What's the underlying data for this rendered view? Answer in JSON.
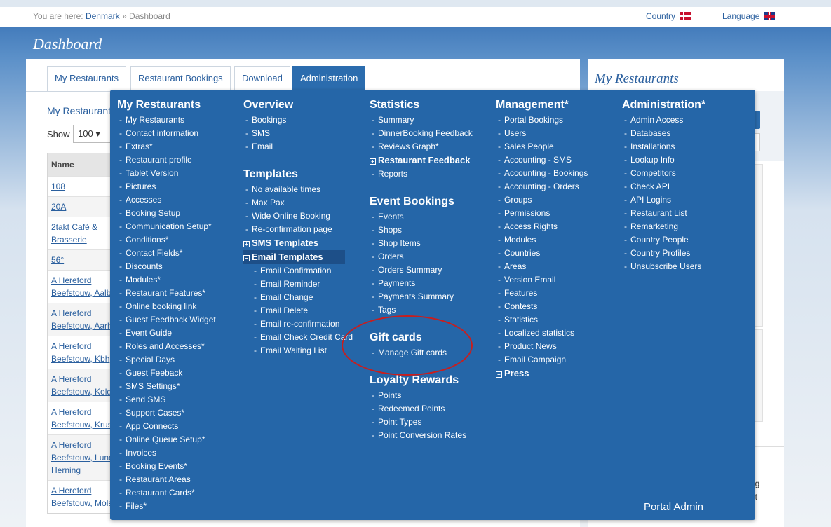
{
  "breadcrumb": {
    "prefix": "You are here:",
    "link": "Denmark",
    "separator": "»",
    "current": "Dashboard"
  },
  "topbar": {
    "country_label": "Country",
    "language_label": "Language"
  },
  "page_title": "Dashboard",
  "tabs": [
    "My Restaurants",
    "Restaurant Bookings",
    "Download",
    "Administration"
  ],
  "active_tab": "Administration",
  "main": {
    "subtitle": "My Restaurants",
    "show_label": "Show",
    "show_value": "100",
    "table_header": "Name",
    "rows": [
      "108",
      "20A",
      "2takt Café &",
      "Brasserie",
      "56°",
      "A Hereford",
      "Beefstouw, Aalb",
      "A Hereford",
      "Beefstouw, Aarh",
      "A Hereford",
      "Beefstouw, Kbh",
      "A Hereford",
      "Beefstouw, Kold",
      "A Hereford",
      "Beefstouw, Krus",
      "A Hereford",
      "Beefstouw, Lund",
      "Herning",
      "A Hereford",
      "Beefstouw, Mols"
    ]
  },
  "side": {
    "title": "My Restaurants",
    "fragments": [
      "r",
      "ng",
      "ut"
    ]
  },
  "menu": {
    "col1": {
      "header": "My Restaurants",
      "items": [
        "My Restaurants",
        "Contact information",
        "Extras*",
        "Restaurant profile",
        "Tablet Version",
        "Pictures",
        "Accesses",
        "Booking Setup",
        "Communication Setup*",
        "Conditions*",
        "Contact Fields*",
        "Discounts",
        "Modules*",
        "Restaurant Features*",
        "Online booking link",
        "Guest Feedback Widget",
        "Event Guide",
        "Roles and Accesses*",
        "Special Days",
        "Guest Feeback",
        "SMS Settings*",
        "Send SMS",
        "Support Cases*",
        "App Connects",
        "Online Queue Setup*",
        "Invoices",
        "Booking Events*",
        "Restaurant Areas",
        "Restaurant Cards*",
        "Files*"
      ]
    },
    "col2": {
      "header": "Overview",
      "items": [
        "Bookings",
        "SMS",
        "Email"
      ],
      "header2": "Templates",
      "items2": [
        "No available times",
        "Max Pax",
        "Wide Online Booking",
        "Re-confirmation page"
      ],
      "sms_templates": "SMS Templates",
      "email_templates": "Email Templates",
      "email_items": [
        "Email Confirmation",
        "Email Reminder",
        "Email Change",
        "Email Delete",
        "Email re-confirmation",
        "Email Check Credit Card",
        "Email Waiting List"
      ]
    },
    "col3": {
      "header": "Statistics",
      "items": [
        "Summary",
        "DinnerBooking Feedback",
        "Reviews Graph*"
      ],
      "restaurant_feedback": "Restaurant Feedback",
      "reports": "Reports",
      "header2": "Event Bookings",
      "items2": [
        "Events",
        "Shops",
        "Shop Items",
        "Orders",
        "Orders Summary",
        "Payments",
        "Payments Summary",
        "Tags"
      ],
      "header3": "Gift cards",
      "items3": [
        "Manage Gift cards"
      ],
      "header4": "Loyalty Rewards",
      "items4": [
        "Points",
        "Redeemed Points",
        "Point Types",
        "Point Conversion Rates"
      ]
    },
    "col4": {
      "header": "Management*",
      "items": [
        "Portal Bookings",
        "Users",
        "Sales People",
        "Accounting - SMS",
        "Accounting - Bookings",
        "Accounting - Orders",
        "Groups",
        "Permissions",
        "Access Rights",
        "Modules",
        "Countries",
        "Areas",
        "Version Email",
        "Features",
        "Contests",
        "Statistics",
        "Localized statistics",
        "Product News",
        "Email Campaign"
      ],
      "press": "Press"
    },
    "col5": {
      "header": "Administration*",
      "items": [
        "Admin Access",
        "Databases",
        "Installations",
        "Lookup Info",
        "Competitors",
        "Check API",
        "API Logins",
        "Restaurant List",
        "Remarketing",
        "Country People",
        "Country Profiles",
        "Unsubscribe Users"
      ]
    },
    "footer": "Portal Admin"
  }
}
